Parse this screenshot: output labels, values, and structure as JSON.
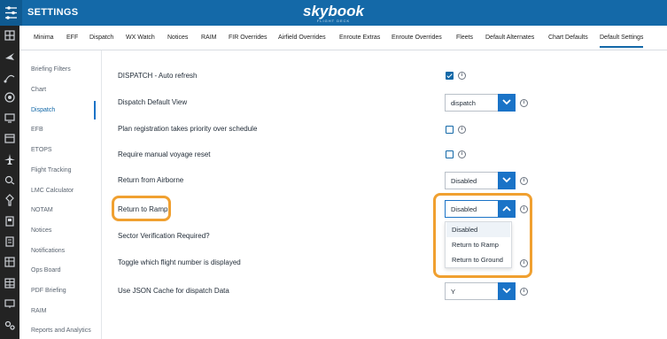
{
  "header": {
    "title": "SETTINGS",
    "brand": "skybook",
    "brand_sub": "FLIGHT DECK"
  },
  "rail_icons": [
    "grid-icon",
    "plane-icon",
    "route-icon",
    "globe-icon",
    "monitor-icon",
    "calendar-icon",
    "aircraft-icon",
    "weather-icon",
    "pin-icon",
    "book-icon",
    "checklist-icon",
    "layers-icon",
    "table-icon",
    "screen-icon",
    "gears-icon"
  ],
  "tabs": [
    "Minima",
    "EFF",
    "Dispatch",
    "WX Watch",
    "Notices",
    "RAIM",
    "FIR Overrides",
    "Airfield Overrides",
    "Enroute Extras",
    "Enroute Overrides",
    "Fleets",
    "Default Alternates",
    "Chart Defaults",
    "Default Settings"
  ],
  "active_tab": "Default Settings",
  "sidebar": {
    "items": [
      "Briefing Filters",
      "Chart",
      "Dispatch",
      "EFB",
      "ETOPS",
      "Flight Tracking",
      "LMC Calculator",
      "NOTAM",
      "Notices",
      "Notifications",
      "Ops Board",
      "PDF Briefing",
      "RAIM",
      "Reports and Analytics"
    ],
    "active": "Dispatch"
  },
  "settings": {
    "auto_refresh": {
      "label": "DISPATCH - Auto refresh",
      "checked": true
    },
    "default_view": {
      "label": "Dispatch Default View",
      "value": "dispatch"
    },
    "plan_registration": {
      "label": "Plan registration takes priority over schedule",
      "checked": false
    },
    "manual_reset": {
      "label": "Require manual voyage reset",
      "checked": false
    },
    "return_airborne": {
      "label": "Return from Airborne",
      "value": "Disabled"
    },
    "return_ramp": {
      "label": "Return to Ramp",
      "value": "Disabled"
    },
    "sector_verification": {
      "label": "Sector Verification Required?"
    },
    "toggle_flight_number": {
      "label": "Toggle which flight number is displayed"
    },
    "json_cache": {
      "label": "Use JSON Cache for dispatch Data",
      "value": "Y"
    }
  },
  "dropdown": {
    "options": [
      "Disabled",
      "Return to Ramp",
      "Return to Ground"
    ],
    "selected": "Disabled"
  },
  "info_glyph": "i",
  "colors": {
    "header": "#1469a8",
    "accent": "#1a73c7",
    "highlight": "#f0a030",
    "rail": "#232323"
  }
}
